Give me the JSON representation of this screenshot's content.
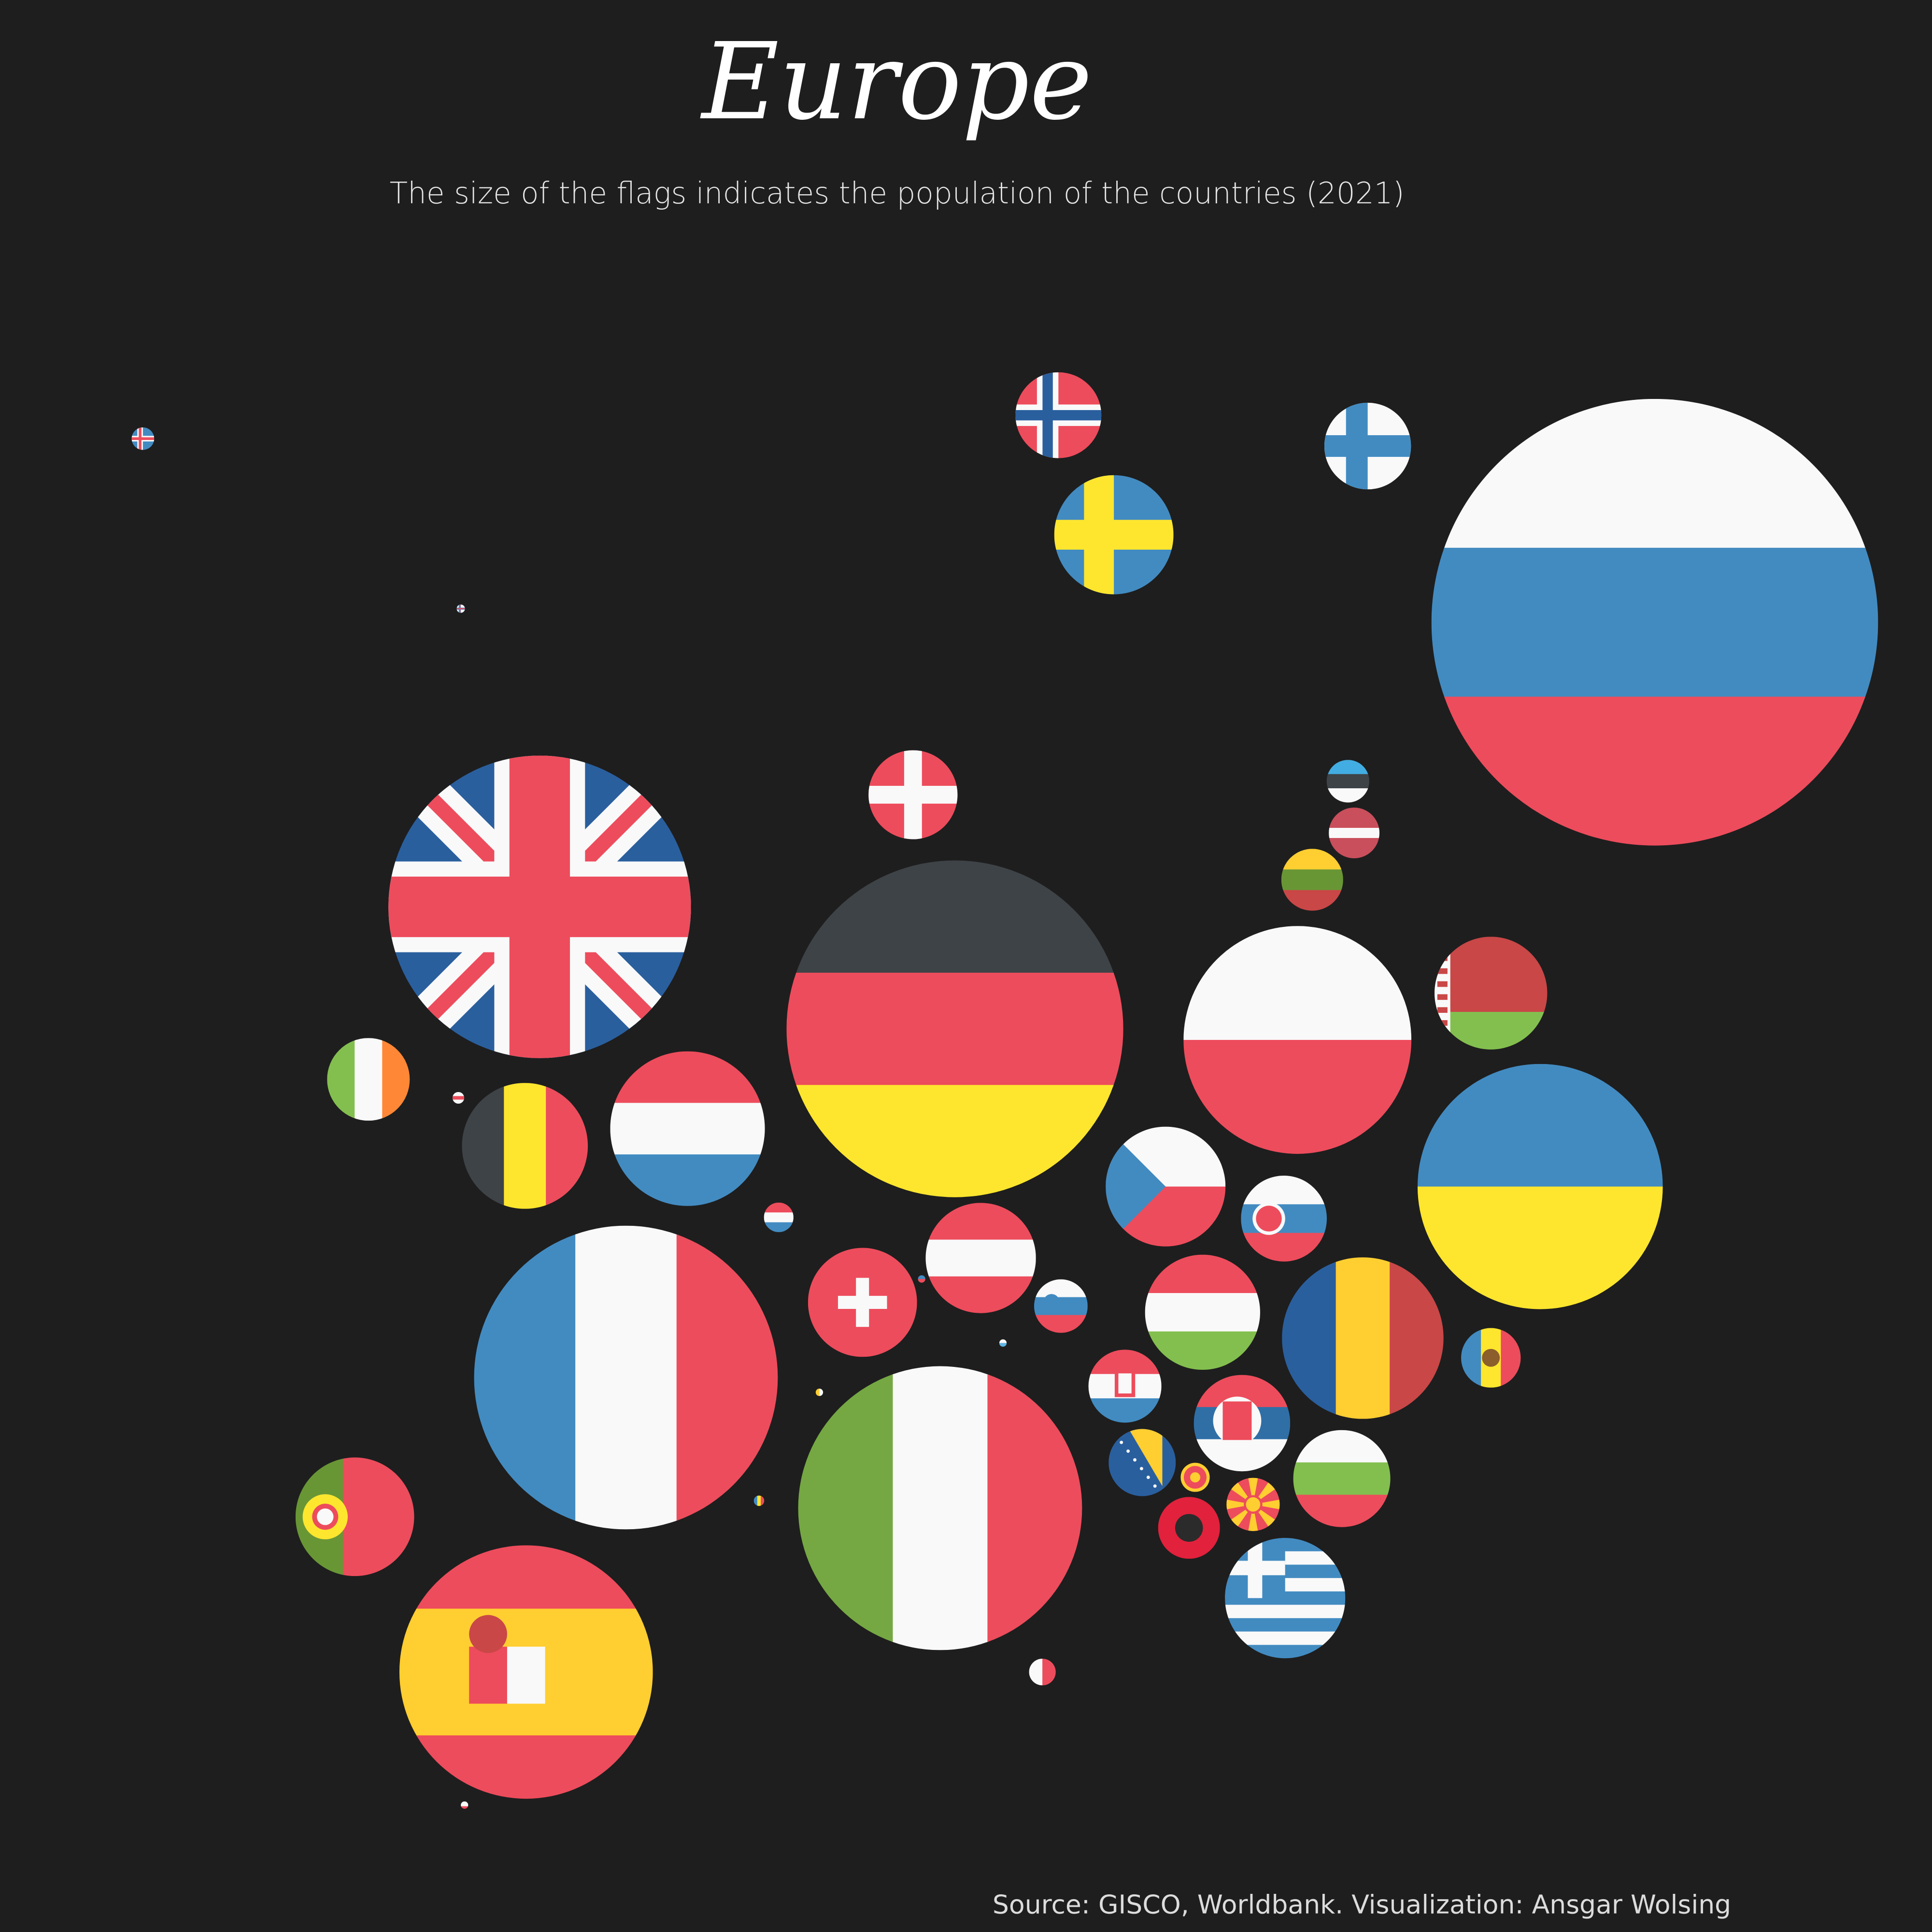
{
  "chart_data": {
    "type": "bubble-map",
    "title": "Europe",
    "subtitle": "The size of the flags indicates the population of the countries (2021)",
    "source": "Source: GISCO, Worldbank. Visualization: Ansgar Wolsing",
    "size_encoding": "population (millions)",
    "countries": [
      {
        "code": "RU",
        "population_m": 146
      },
      {
        "code": "DE",
        "population_m": 83
      },
      {
        "code": "FR",
        "population_m": 67.5
      },
      {
        "code": "GB",
        "population_m": 67
      },
      {
        "code": "IT",
        "population_m": 59
      },
      {
        "code": "ES",
        "population_m": 47
      },
      {
        "code": "UA",
        "population_m": 44
      },
      {
        "code": "PL",
        "population_m": 38
      },
      {
        "code": "RO",
        "population_m": 19.1
      },
      {
        "code": "NL",
        "population_m": 17.5
      },
      {
        "code": "BE",
        "population_m": 11.6
      },
      {
        "code": "CZ",
        "population_m": 10.5
      },
      {
        "code": "GR",
        "population_m": 10.6
      },
      {
        "code": "SE",
        "population_m": 10.4
      },
      {
        "code": "PT",
        "population_m": 10.3
      },
      {
        "code": "HU",
        "population_m": 9.7
      },
      {
        "code": "BY",
        "population_m": 9.3
      },
      {
        "code": "AT",
        "population_m": 8.9
      },
      {
        "code": "CH",
        "population_m": 8.7
      },
      {
        "code": "BG",
        "population_m": 6.9
      },
      {
        "code": "RS",
        "population_m": 6.8
      },
      {
        "code": "DK",
        "population_m": 5.8
      },
      {
        "code": "FI",
        "population_m": 5.5
      },
      {
        "code": "NO",
        "population_m": 5.4
      },
      {
        "code": "SK",
        "population_m": 5.4
      },
      {
        "code": "IE",
        "population_m": 5.0
      },
      {
        "code": "HR",
        "population_m": 3.9
      },
      {
        "code": "BA",
        "population_m": 3.3
      },
      {
        "code": "LT",
        "population_m": 2.8
      },
      {
        "code": "AL",
        "population_m": 2.8
      },
      {
        "code": "MD",
        "population_m": 2.6
      },
      {
        "code": "SI",
        "population_m": 2.1
      },
      {
        "code": "MK",
        "population_m": 2.07
      },
      {
        "code": "LV",
        "population_m": 1.88
      },
      {
        "code": "EE",
        "population_m": 1.33
      },
      {
        "code": "LU",
        "population_m": 0.64
      },
      {
        "code": "ME",
        "population_m": 0.62
      },
      {
        "code": "MT",
        "population_m": 0.52
      },
      {
        "code": "IS",
        "population_m": 0.37
      },
      {
        "code": "AD",
        "population_m": 0.08
      },
      {
        "code": "FO",
        "population_m": 0.05
      },
      {
        "code": "JE",
        "population_m": 0.1
      },
      {
        "code": "LI",
        "population_m": 0.04
      },
      {
        "code": "SM",
        "population_m": 0.03
      },
      {
        "code": "VA",
        "population_m": 0.03
      },
      {
        "code": "GI",
        "population_m": 0.03
      }
    ]
  },
  "palette": {
    "background": "#1e1e1e",
    "red": "#ED4C5C",
    "white": "#F9F9F9",
    "blue": "#428BC1",
    "darkblue": "#2A5F9E",
    "yellow": "#FFE62E",
    "gold": "#FFCE31",
    "dark": "#3E4347",
    "green": "#75A843",
    "lightgreen": "#83BF4F",
    "orange": "#FF8736"
  }
}
